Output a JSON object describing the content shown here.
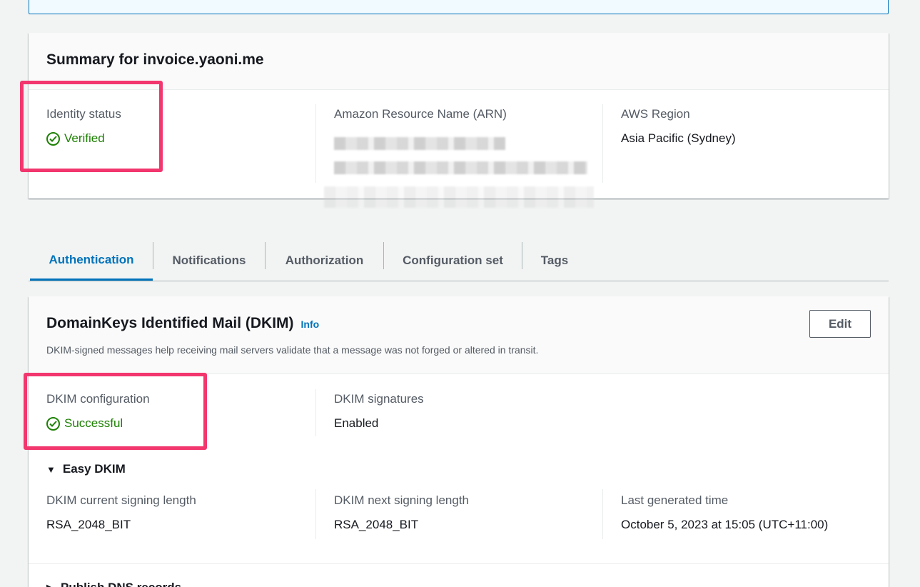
{
  "summary": {
    "title": "Summary for invoice.yaoni.me",
    "identity_status_label": "Identity status",
    "identity_status_value": "Verified",
    "arn_label": "Amazon Resource Name (ARN)",
    "region_label": "AWS Region",
    "region_value": "Asia Pacific (Sydney)"
  },
  "tabs": [
    {
      "label": "Authentication",
      "active": true
    },
    {
      "label": "Notifications",
      "active": false
    },
    {
      "label": "Authorization",
      "active": false
    },
    {
      "label": "Configuration set",
      "active": false
    },
    {
      "label": "Tags",
      "active": false
    }
  ],
  "dkim": {
    "title": "DomainKeys Identified Mail (DKIM)",
    "info_label": "Info",
    "description": "DKIM-signed messages help receiving mail servers validate that a message was not forged or altered in transit.",
    "edit_label": "Edit",
    "config_label": "DKIM configuration",
    "config_value": "Successful",
    "signatures_label": "DKIM signatures",
    "signatures_value": "Enabled",
    "easy_dkim_label": "Easy DKIM",
    "current_length_label": "DKIM current signing length",
    "current_length_value": "RSA_2048_BIT",
    "next_length_label": "DKIM next signing length",
    "next_length_value": "RSA_2048_BIT",
    "last_generated_label": "Last generated time",
    "last_generated_value": "October 5, 2023 at 15:05 (UTC+11:00)",
    "publish_dns_label": "Publish DNS records"
  },
  "colors": {
    "accent": "#0073bb",
    "success": "#1d8102",
    "highlight": "#f2366e"
  }
}
